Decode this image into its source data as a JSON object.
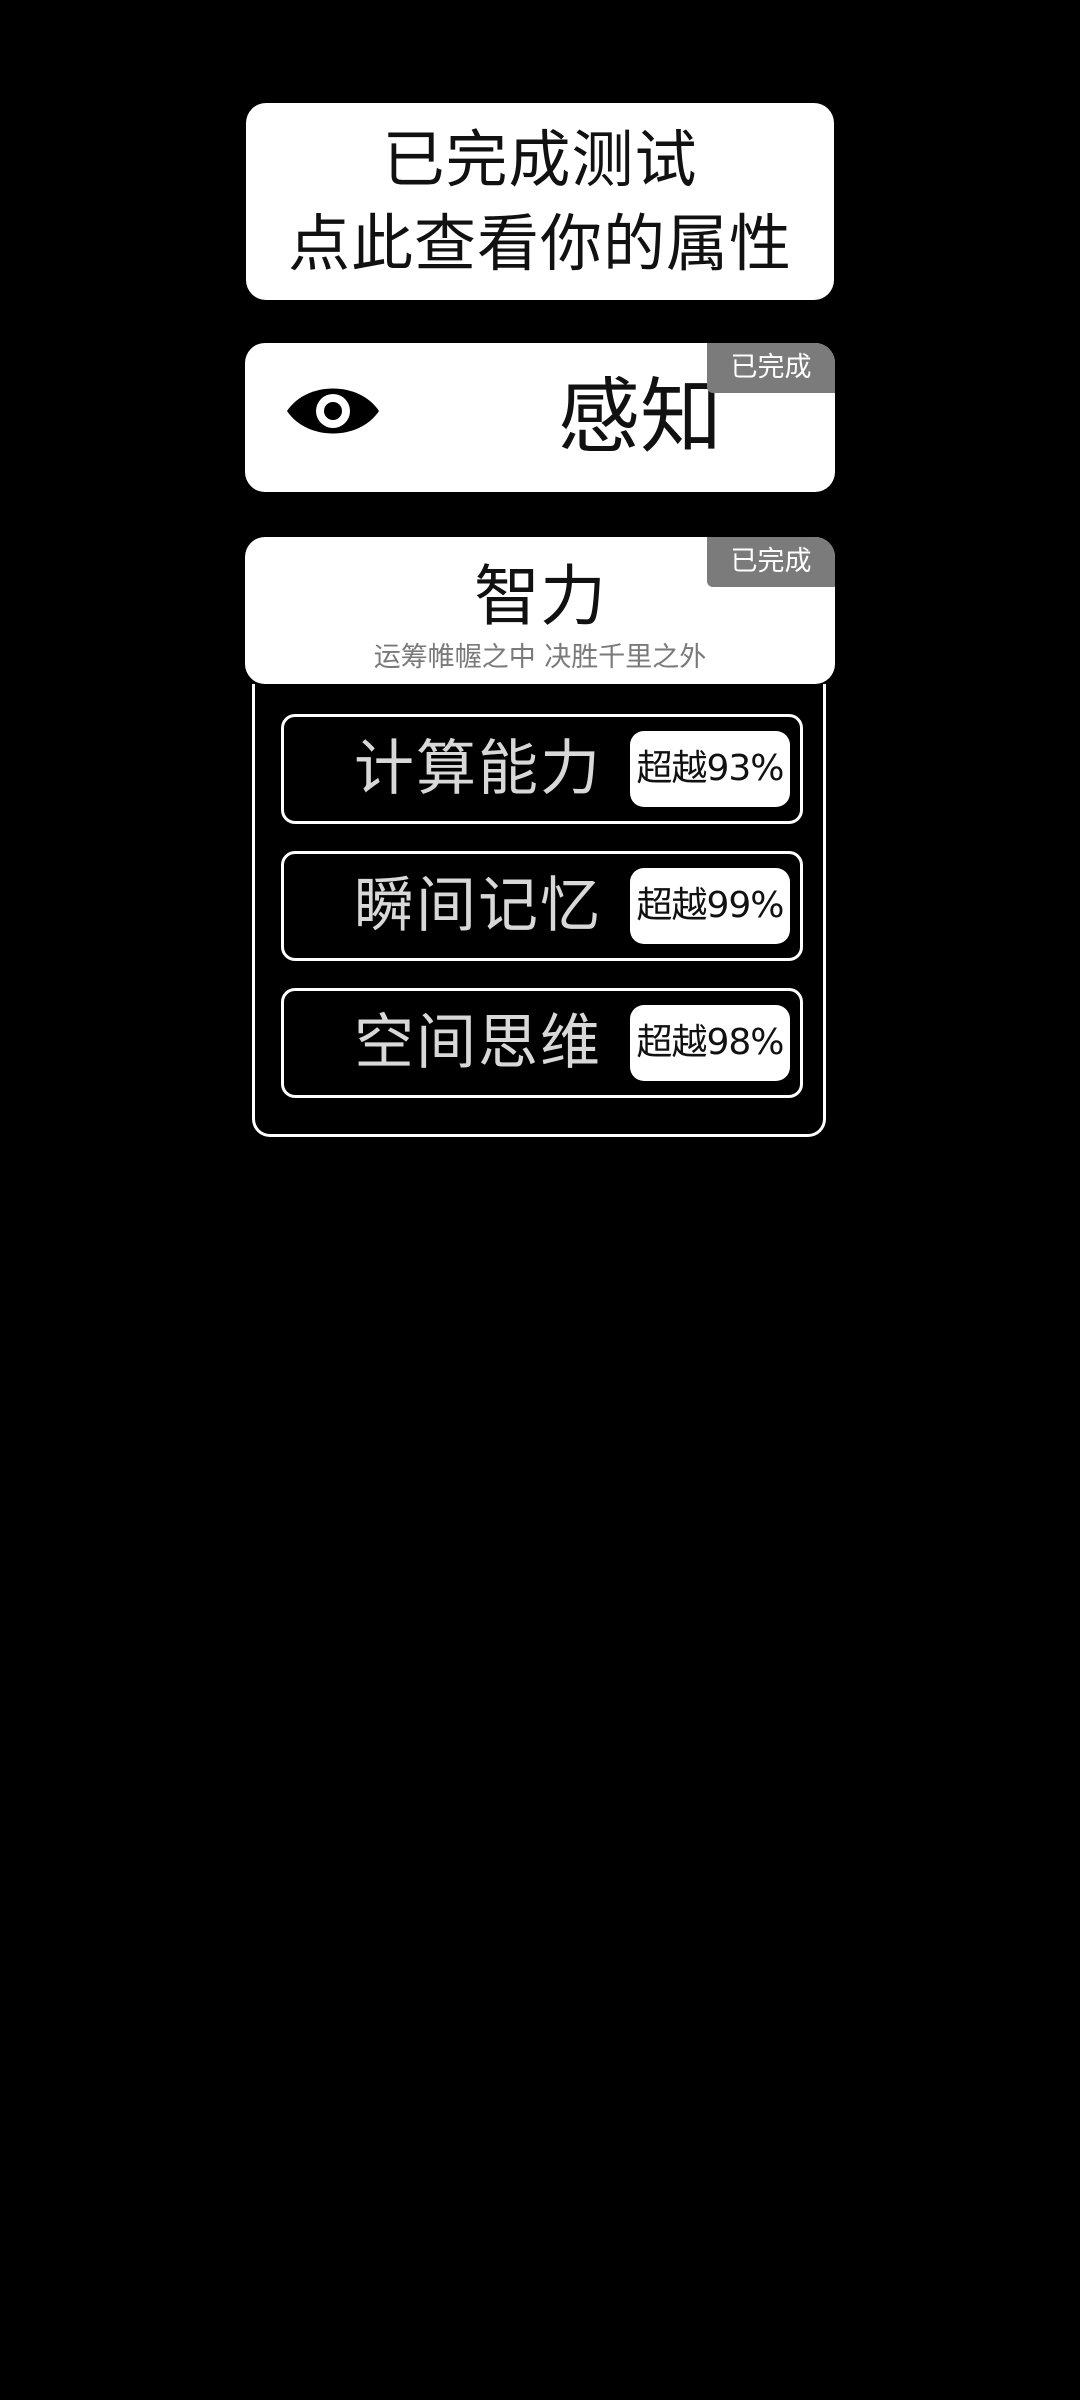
{
  "result": {
    "line1": "已完成测试",
    "line2": "点此查看你的属性"
  },
  "perception": {
    "title": "感知",
    "badge": "已完成",
    "icon": "eye-icon"
  },
  "intelligence": {
    "title": "智力",
    "subtitle": "运筹帷幄之中 决胜千里之外",
    "badge": "已完成",
    "items": [
      {
        "label": "计算能力",
        "score": "超越93%"
      },
      {
        "label": "瞬间记忆",
        "score": "超越99%"
      },
      {
        "label": "空间思维",
        "score": "超越98%"
      }
    ]
  },
  "colors": {
    "background": "#000000",
    "card": "#ffffff",
    "badge": "#7b7b7b",
    "subtitle": "#7a7a7a"
  }
}
